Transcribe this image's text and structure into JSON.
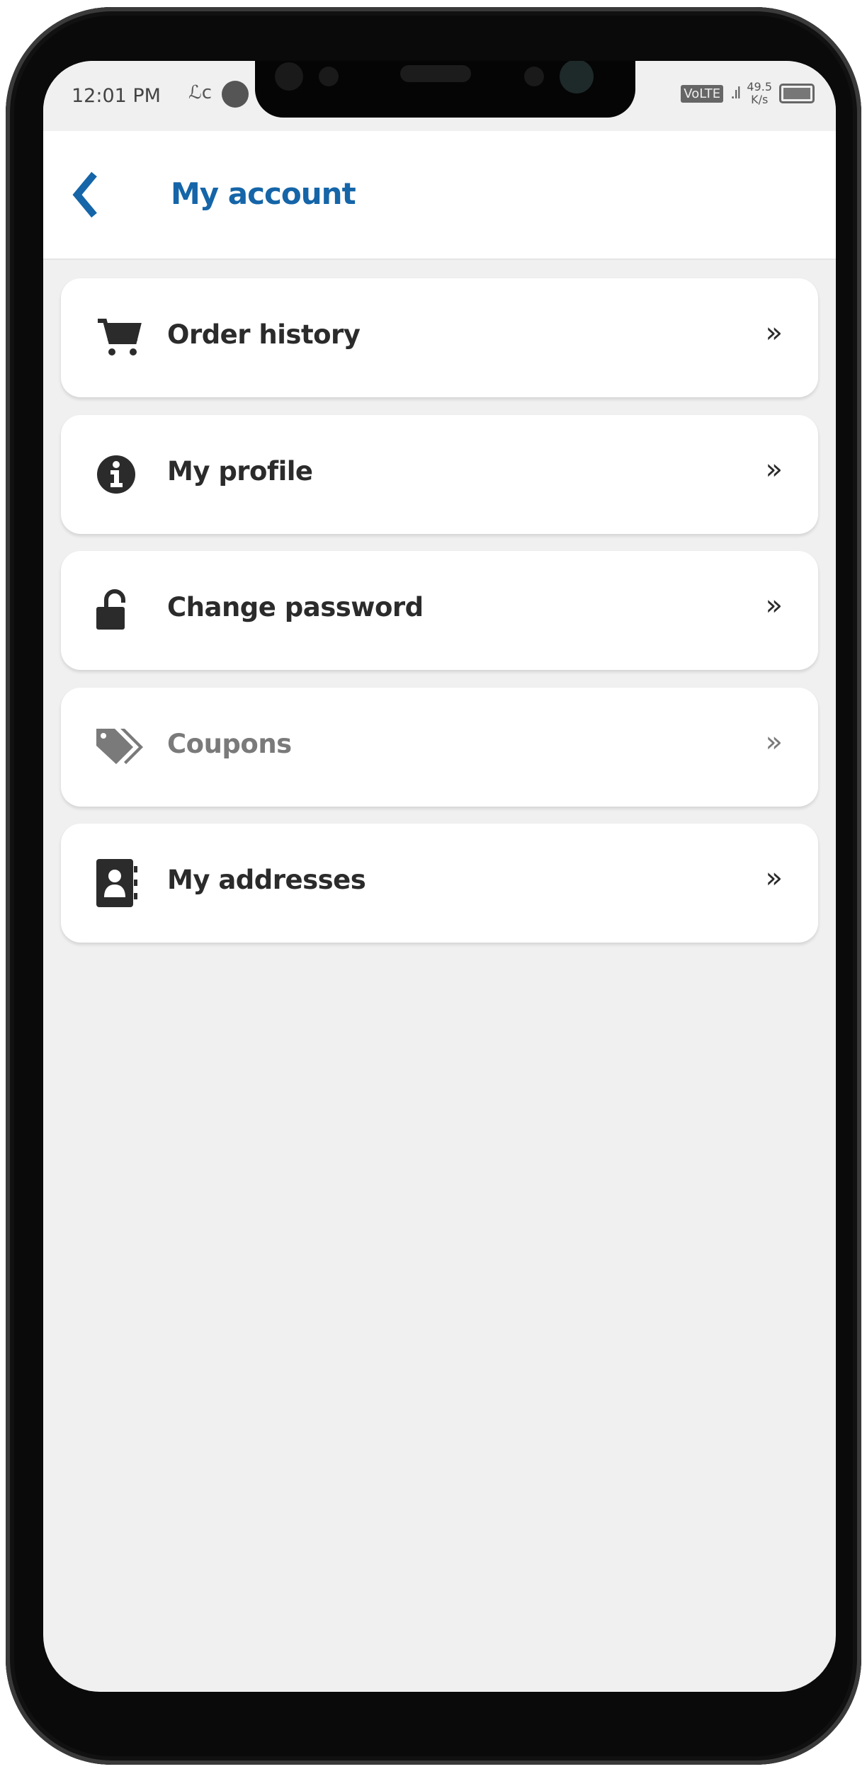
{
  "status_bar": {
    "time": "12:01 PM",
    "network": "VoLTE",
    "speed_value": "49.5",
    "speed_unit": "K/s"
  },
  "header": {
    "title": "My account",
    "back_icon": "chevron-left-icon"
  },
  "colors": {
    "accent": "#1565a8",
    "text": "#2b2b2b",
    "disabled_text": "#7a7a7a",
    "background": "#f0f0f0"
  },
  "menu": {
    "items": [
      {
        "label": "Order history",
        "icon": "cart-icon"
      },
      {
        "label": "My profile",
        "icon": "info-circle-icon"
      },
      {
        "label": "Change password",
        "icon": "unlock-icon"
      },
      {
        "label": "Coupons",
        "icon": "tags-icon",
        "disabled": true
      },
      {
        "label": "My addresses",
        "icon": "address-book-icon"
      }
    ],
    "chevron": "»"
  }
}
